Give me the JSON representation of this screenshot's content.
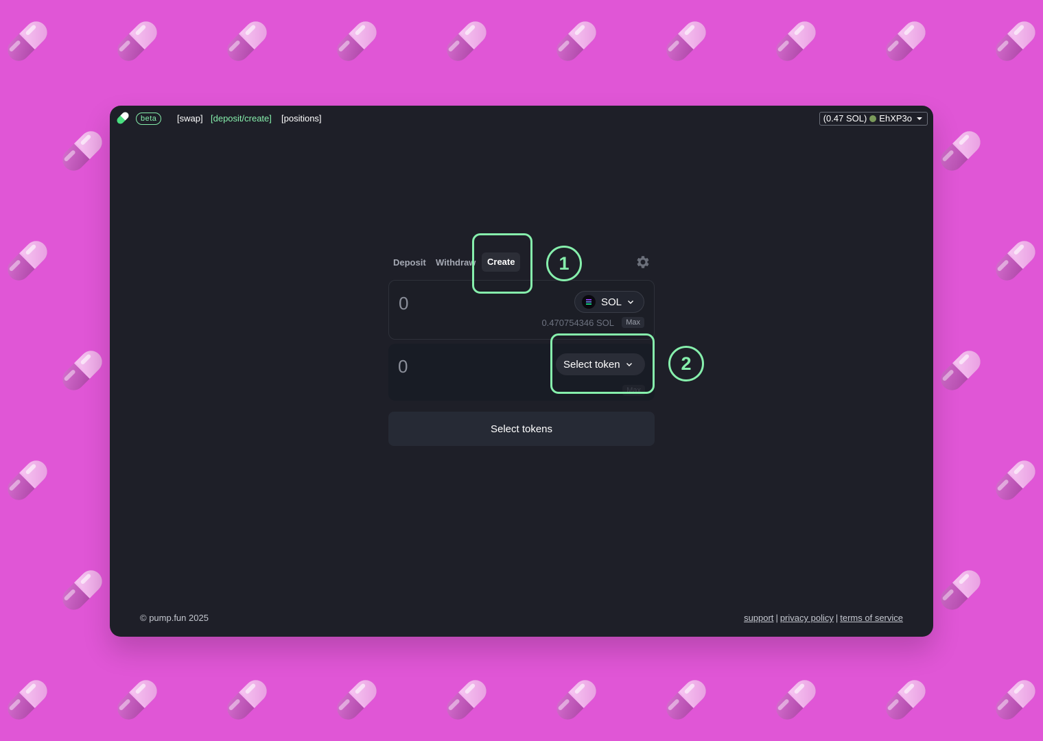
{
  "colors": {
    "background": "#e056d6",
    "window": "#1e1f28",
    "accent_green": "#86efac",
    "pill_pink": "#e88ee0"
  },
  "header": {
    "logo_icon": "pill-icon",
    "badge": "beta",
    "nav": [
      "[swap]",
      "[deposit/create]",
      "[positions]"
    ],
    "active_nav": "[deposit/create]",
    "wallet": {
      "balance": "(0.47 SOL)",
      "address": "EhXP3o"
    }
  },
  "tabs": {
    "items": [
      "Deposit",
      "Withdraw",
      "Create"
    ],
    "active": "Create"
  },
  "settings_icon": "gear-icon",
  "input_from": {
    "amount": "0",
    "token": "SOL",
    "balance": "0.470754346 SOL",
    "max_label": "Max"
  },
  "input_to": {
    "amount": "0",
    "token_placeholder": "Select token",
    "max_label": "Max"
  },
  "action_button": "Select tokens",
  "annotations": [
    "1",
    "2"
  ],
  "footer": {
    "copyright": "© pump.fun 2025",
    "links": [
      "support",
      "privacy policy",
      "terms of service"
    ],
    "separator": "|"
  }
}
